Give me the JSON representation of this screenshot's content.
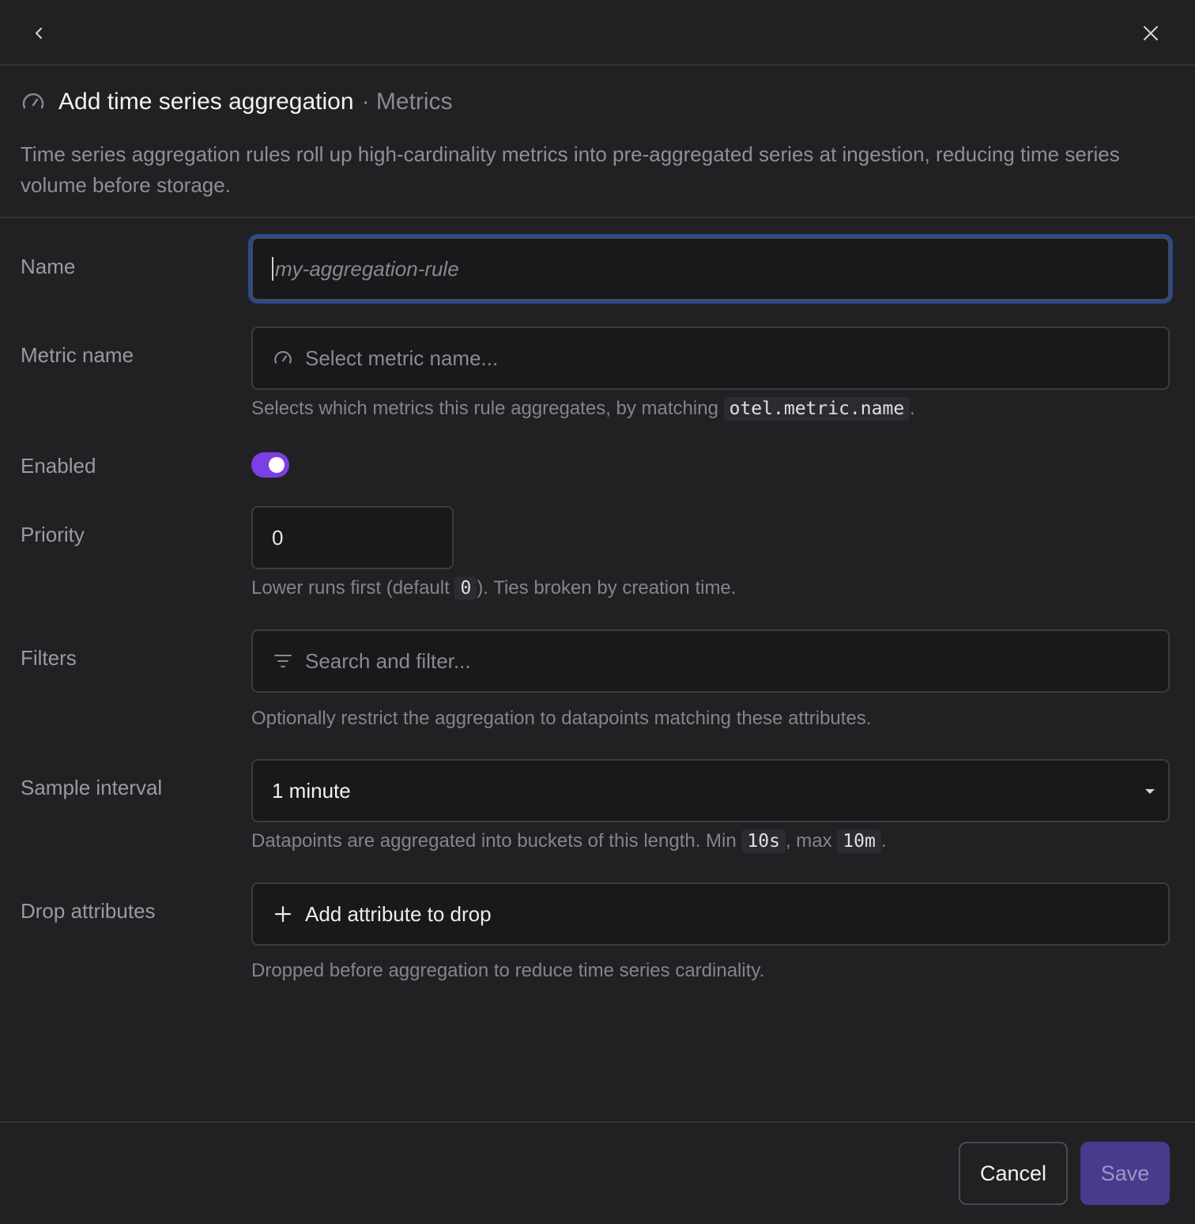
{
  "header": {
    "title": "Add time series aggregation",
    "crumb": "· Metrics",
    "description": "Time series aggregation rules roll up high-cardinality metrics into pre-aggregated series at ingestion, reducing time series volume before storage."
  },
  "form": {
    "name": {
      "label": "Name",
      "placeholder": "my-aggregation-rule",
      "value": ""
    },
    "metric_name": {
      "label": "Metric name",
      "placeholder": "Select metric name...",
      "help_prefix": "Selects which metrics this rule aggregates, by matching",
      "help_code": "otel.metric.name",
      "help_suffix": "."
    },
    "enabled": {
      "label": "Enabled",
      "value": true
    },
    "priority": {
      "label": "Priority",
      "value": "0",
      "help_prefix": "Lower runs first (default",
      "help_code": "0",
      "help_suffix": "). Ties broken by creation time."
    },
    "filters": {
      "label": "Filters",
      "placeholder": "Search and filter...",
      "help": "Optionally restrict the aggregation to datapoints matching these attributes."
    },
    "sample_interval": {
      "label": "Sample interval",
      "value": "1 minute",
      "help_prefix": "Datapoints are aggregated into buckets of this length. Min",
      "help_code_min": "10s",
      "help_mid": ", max",
      "help_code_max": "10m",
      "help_suffix": "."
    },
    "drop_attributes": {
      "label": "Drop attributes",
      "button": "Add attribute to drop",
      "help": "Dropped before aggregation to reduce time series cardinality."
    }
  },
  "footer": {
    "cancel": "Cancel",
    "save": "Save"
  },
  "colors": {
    "accent": "#7b3fe4",
    "focus_ring": "#2b4a8c",
    "save_bg": "#4a3a8e"
  },
  "icons": {
    "back": "chevron-left-icon",
    "close": "close-icon",
    "title": "gauge-icon",
    "metric": "gauge-icon",
    "filters": "filter-icon",
    "select": "caret-down-icon",
    "add": "plus-icon"
  }
}
